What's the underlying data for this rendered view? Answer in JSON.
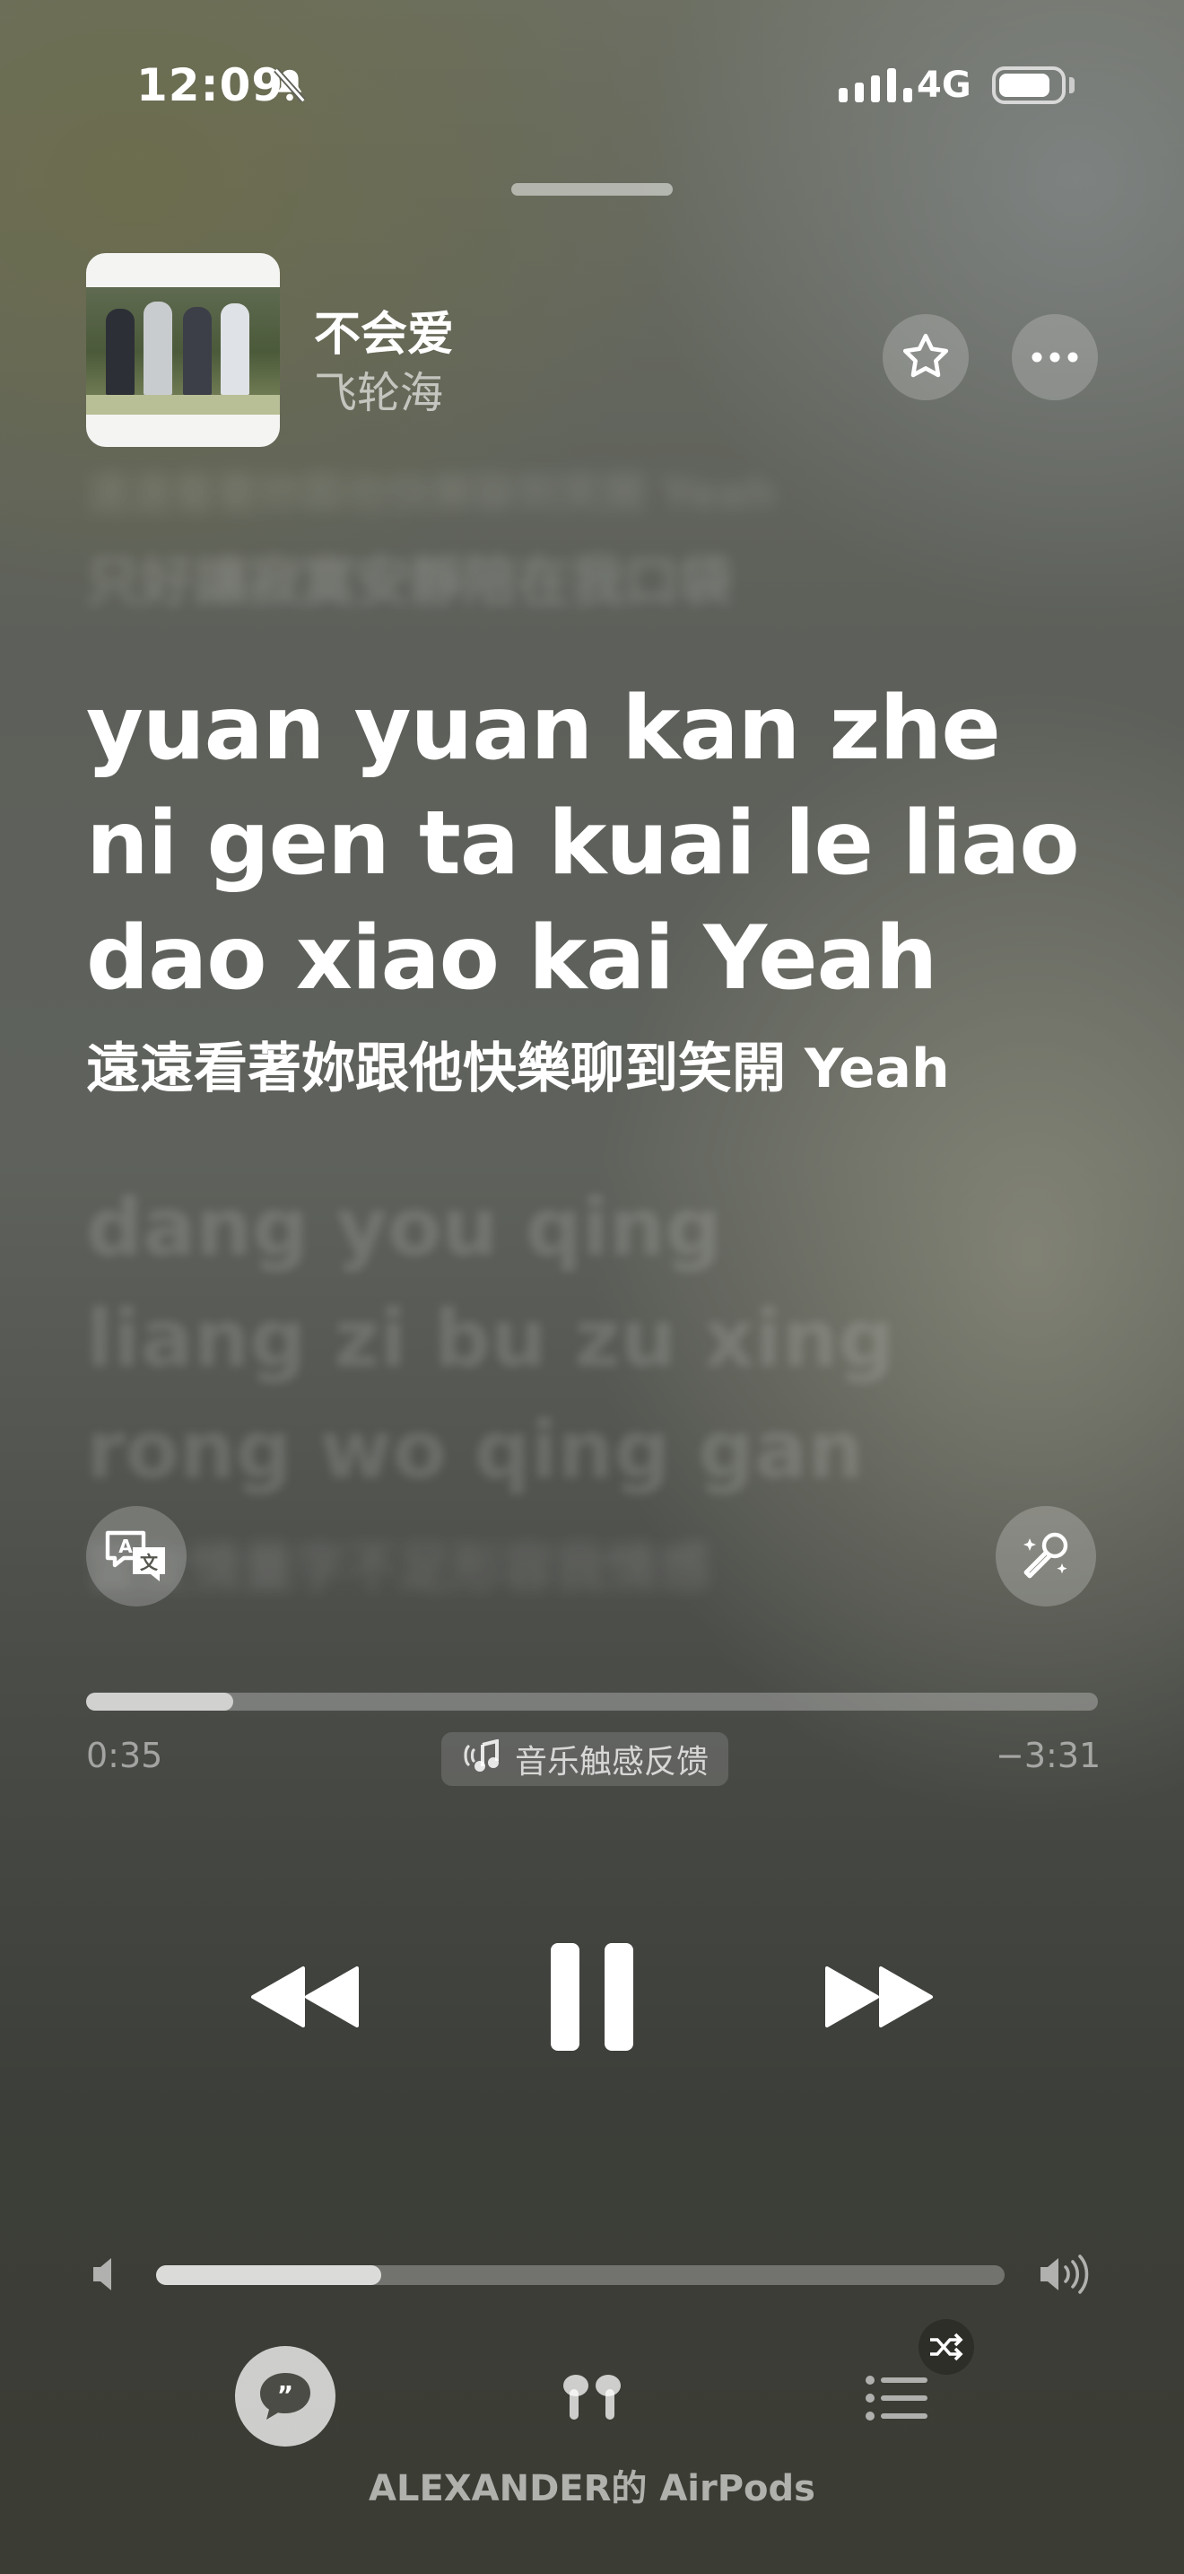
{
  "status_bar": {
    "time": "12:09",
    "silent_icon": "bell-slash-icon",
    "network": "4G",
    "battery_level": 0.85
  },
  "now_playing": {
    "title": "不会爱",
    "artist": "飞轮海",
    "album_art_icon": "album-art",
    "favorite_icon": "star-icon",
    "more_icon": "ellipsis-icon"
  },
  "lyrics": {
    "previous_faint": "遠遠看著妳跟他快樂聊到笑開 Yeah",
    "previous": "只好讓寂寞安靜陪在我口袋",
    "current_line": "yuan yuan kan zhe ni gen ta kuai le liao dao xiao kai Yeah",
    "current_translation": "遠遠看著妳跟他快樂聊到笑開 Yeah",
    "next_lines": [
      "dang you qing",
      "liang zi bu zu xing",
      "rong wo qing gan"
    ],
    "next_translation": "當友情量字不足形容我情感",
    "translate_icon": "translate-icon",
    "sing_icon": "microphone-sparkle-icon"
  },
  "playback": {
    "elapsed": "0:35",
    "remaining": "−3:31",
    "progress": 0.145,
    "haptics_label": "音乐触感反馈",
    "haptics_icon": "music-haptics-icon"
  },
  "controls": {
    "previous_icon": "backward-icon",
    "play_pause_icon": "pause-icon",
    "next_icon": "forward-icon"
  },
  "volume": {
    "level": 0.265,
    "low_icon": "speaker-low-icon",
    "high_icon": "speaker-high-icon"
  },
  "bottom_bar": {
    "lyrics_icon": "quote-bubble-icon",
    "airplay_icon": "airpods-icon",
    "queue_icon": "list-icon",
    "shuffle_icon": "shuffle-icon",
    "device_name": "ALEXANDER的 AirPods"
  },
  "colors": {
    "accent": "#ffffff",
    "background_top": "#6c6f62",
    "background_bottom": "#3b3c33"
  }
}
